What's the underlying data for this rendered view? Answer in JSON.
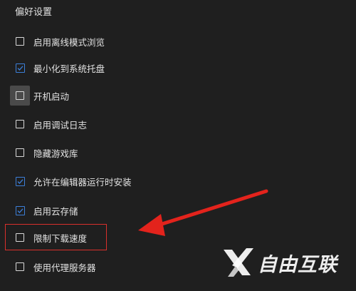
{
  "section": {
    "title": "偏好设置"
  },
  "options": [
    {
      "label": "启用离线模式浏览",
      "checked": false
    },
    {
      "label": "最小化到系统托盘",
      "checked": true
    },
    {
      "label": "开机启动",
      "checked": false
    },
    {
      "label": "启用调试日志",
      "checked": false
    },
    {
      "label": "隐藏游戏库",
      "checked": false
    },
    {
      "label": "允许在编辑器运行时安装",
      "checked": true
    },
    {
      "label": "启用云存储",
      "checked": true
    },
    {
      "label": "限制下载速度",
      "checked": false
    },
    {
      "label": "使用代理服务器",
      "checked": false
    }
  ],
  "watermark": {
    "text": "自由互联"
  },
  "colors": {
    "background": "#1f1f1f",
    "check_accent": "#3c7fd9",
    "highlight": "#d9302c",
    "hover_bg": "#4a4a4a"
  }
}
